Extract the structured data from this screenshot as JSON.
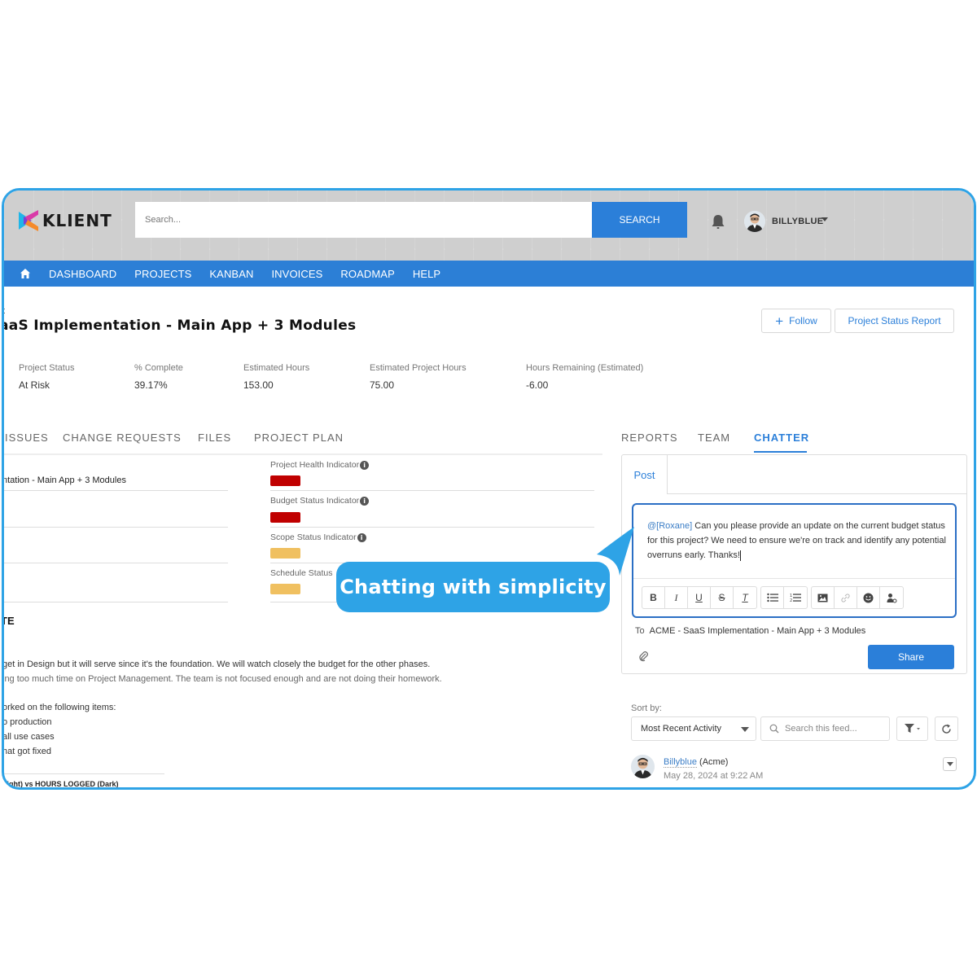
{
  "header": {
    "logo_text": "KLIENT",
    "search_placeholder": "Search...",
    "search_button": "SEARCH",
    "user_name": "BILLYBLUE"
  },
  "nav": {
    "items": [
      "DASHBOARD",
      "PROJECTS",
      "KANBAN",
      "INVOICES",
      "ROADMAP",
      "HELP"
    ]
  },
  "project": {
    "breadcrumb": "t",
    "title": "aaS Implementation - Main App + 3 Modules",
    "follow_label": "Follow",
    "report_label": "Project Status Report",
    "stats": [
      {
        "label": "Project Status",
        "value": "At Risk"
      },
      {
        "label": "% Complete",
        "value": "39.17%"
      },
      {
        "label": "Estimated Hours",
        "value": "153.00"
      },
      {
        "label": "Estimated Project Hours",
        "value": "75.00"
      },
      {
        "label": "Hours Remaining (Estimated)",
        "value": "-6.00"
      }
    ]
  },
  "tabs_left": [
    "ISSUES",
    "CHANGE REQUESTS",
    "FILES",
    "PROJECT PLAN"
  ],
  "tabs_right": [
    "REPORTS",
    "TEAM",
    "CHATTER"
  ],
  "active_tab": "CHATTER",
  "details": {
    "project_name_partial": "ntation - Main App + 3 Modules",
    "indicators": [
      {
        "label": "Project Health Indicator",
        "status": "red",
        "color": "#c00000"
      },
      {
        "label": "Budget Status Indicator",
        "status": "red",
        "color": "#c00000"
      },
      {
        "label": "Scope Status Indicator",
        "status": "yellow",
        "color": "#f0c060"
      },
      {
        "label": "Schedule Status",
        "status": "yellow",
        "color": "#f0c060"
      }
    ]
  },
  "notes": {
    "heading": "TE",
    "lines": [
      "get in Design but it will serve since it's the foundation. We will watch closely the budget for the other phases.",
      "ing too much time on Project Management. The team is not focused enough and are not doing their homework.",
      "orked on the following items:",
      "o production",
      " all use cases",
      "hat got fixed"
    ],
    "chart_caption": "Light) vs HOURS LOGGED (Dark)"
  },
  "chatter": {
    "post_tab": "Post",
    "mention": "@[Roxane]",
    "message": " Can you please provide an update on the current budget status for this project? We need to ensure we're on track and identify any potential overruns early. Thanks!",
    "toolbar": {
      "bold": "B",
      "italic": "I",
      "underline": "U",
      "strike": "S",
      "clear": "T",
      "bullets": "≡",
      "numbered": "≡",
      "image": "▣",
      "link": "⚭",
      "emoji": "☻",
      "mention": "👤"
    },
    "to_label": "To",
    "to_value": "ACME - SaaS Implementation - Main App + 3 Modules",
    "share_label": "Share",
    "sort_label": "Sort by:",
    "sort_value": "Most Recent Activity",
    "feed_search_placeholder": "Search this feed...",
    "feed_item": {
      "author": "Billyblue",
      "org": " (Acme)",
      "time": "May 28, 2024 at 9:22 AM"
    }
  },
  "callout": {
    "text": "Chatting with simplicity",
    "color": "#2ea3e6"
  },
  "colors": {
    "brand_blue": "#2c7fd6",
    "frame_border": "#2ea3e6"
  }
}
